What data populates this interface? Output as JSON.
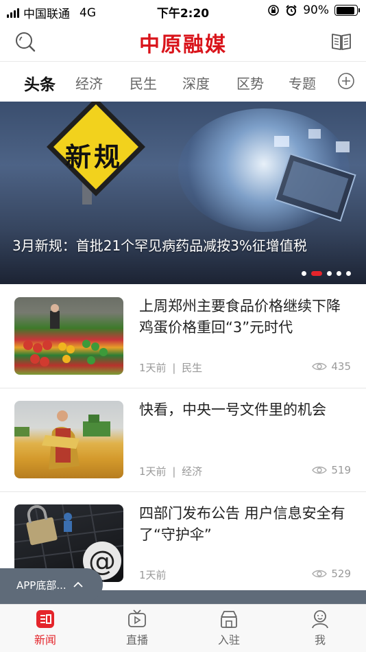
{
  "status_bar": {
    "carrier": "中国联通",
    "network": "4G",
    "time": "下午2:20",
    "battery": "90%",
    "battery_level": 0.9
  },
  "header": {
    "title": "中原融媒",
    "left_icon": "search-icon",
    "right_icon": "book-icon"
  },
  "tabs": [
    {
      "label": "头条",
      "active": true
    },
    {
      "label": "经济",
      "active": false
    },
    {
      "label": "民生",
      "active": false
    },
    {
      "label": "深度",
      "active": false
    },
    {
      "label": "区势",
      "active": false
    },
    {
      "label": "专题",
      "active": false
    }
  ],
  "banner": {
    "sign_text": "新规",
    "caption": "3月新规：首批21个罕见病药品减按3%征增值税",
    "slide_count": 5,
    "active_slide": 2
  },
  "news": [
    {
      "headline": "上周郑州主要食品价格继续下降 鸡蛋价格重回“3”元时代",
      "time": "1天前",
      "category": "民生",
      "separator": "|",
      "views": "435"
    },
    {
      "headline": "快看，中央一号文件里的机会",
      "time": "1天前",
      "category": "经济",
      "separator": "|",
      "views": "519"
    },
    {
      "headline": "四部门发布公告 用户信息安全有了“守护伞”",
      "time": "1天前",
      "category": "",
      "separator": "",
      "views": "529"
    }
  ],
  "floating_bar": {
    "label": "APP底部...",
    "icon": "chevron-up-icon"
  },
  "tabbar": [
    {
      "label": "新闻",
      "icon": "news-icon",
      "active": true
    },
    {
      "label": "直播",
      "icon": "tv-icon",
      "active": false
    },
    {
      "label": "入驻",
      "icon": "store-icon",
      "active": false
    },
    {
      "label": "我",
      "icon": "user-icon",
      "active": false
    }
  ],
  "colors": {
    "brand_red": "#d9141b",
    "accent_red": "#e4252b",
    "muted": "#999999"
  }
}
